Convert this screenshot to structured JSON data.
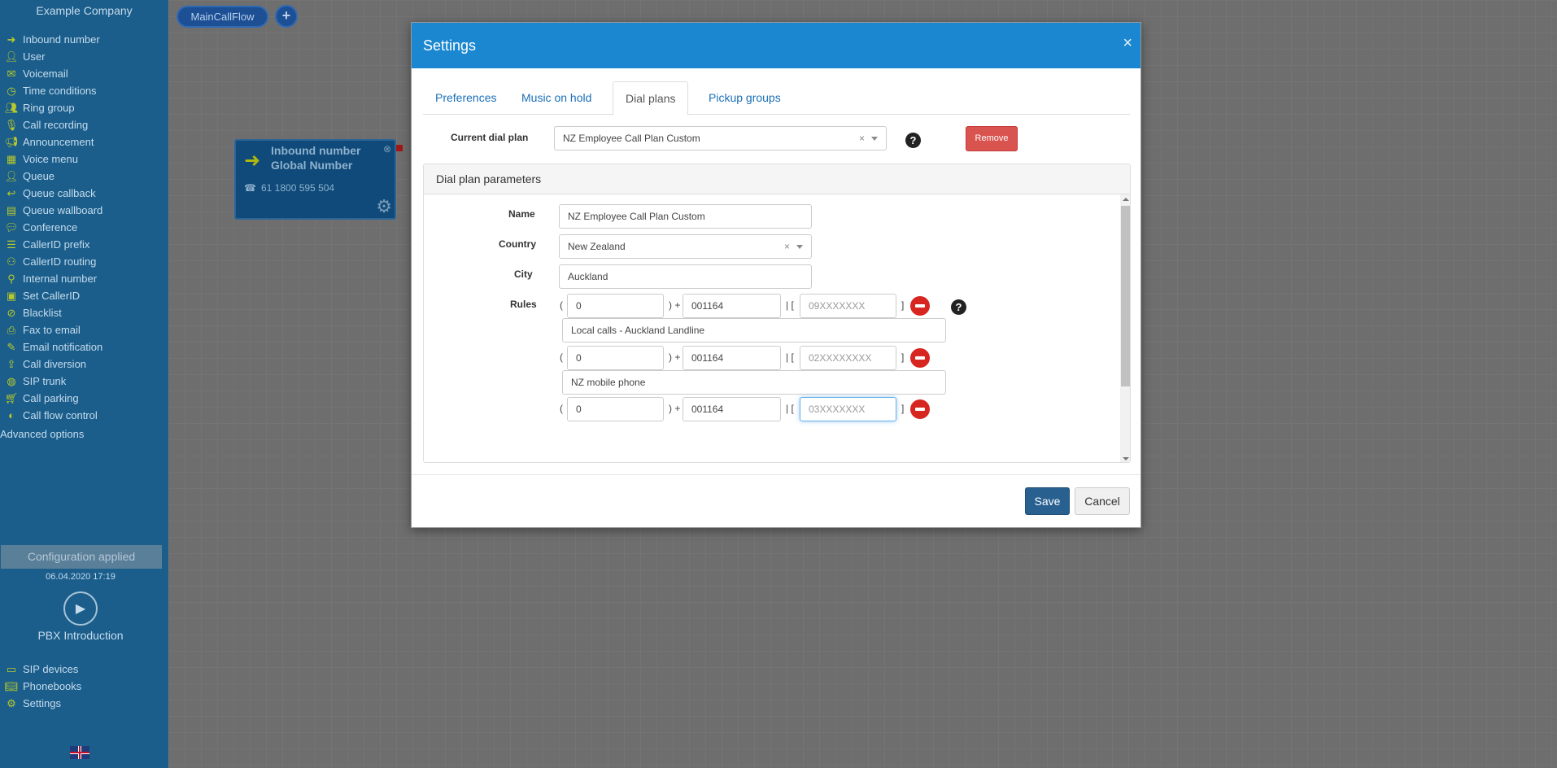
{
  "sidebar": {
    "company": "Example Company",
    "items": [
      {
        "label": "Inbound number",
        "icon": "arrow-right-icon"
      },
      {
        "label": "User",
        "icon": "user-icon"
      },
      {
        "label": "Voicemail",
        "icon": "envelope-icon"
      },
      {
        "label": "Time conditions",
        "icon": "clock-icon"
      },
      {
        "label": "Ring group",
        "icon": "users-icon"
      },
      {
        "label": "Call recording",
        "icon": "microphone-icon"
      },
      {
        "label": "Announcement",
        "icon": "megaphone-icon"
      },
      {
        "label": "Voice menu",
        "icon": "grid-icon"
      },
      {
        "label": "Queue",
        "icon": "user-plus-icon"
      },
      {
        "label": "Queue callback",
        "icon": "reply-icon"
      },
      {
        "label": "Queue wallboard",
        "icon": "table-icon"
      },
      {
        "label": "Conference",
        "icon": "comments-icon"
      },
      {
        "label": "CallerID prefix",
        "icon": "list-icon"
      },
      {
        "label": "CallerID routing",
        "icon": "sitemap-icon"
      },
      {
        "label": "Internal number",
        "icon": "map-marker-icon"
      },
      {
        "label": "Set CallerID",
        "icon": "id-card-icon"
      },
      {
        "label": "Blacklist",
        "icon": "ban-icon"
      },
      {
        "label": "Fax to email",
        "icon": "fax-icon"
      },
      {
        "label": "Email notification",
        "icon": "email-notify-icon"
      },
      {
        "label": "Call diversion",
        "icon": "upload-icon"
      },
      {
        "label": "SIP trunk",
        "icon": "globe-icon"
      },
      {
        "label": "Call parking",
        "icon": "cart-icon"
      },
      {
        "label": "Call flow control",
        "icon": "toggle-icon"
      }
    ],
    "advanced": "Advanced options",
    "config_applied": "Configuration applied",
    "config_time": "06.04.2020 17:19",
    "pbx_intro": "PBX Introduction",
    "bottom_items": [
      {
        "label": "SIP devices",
        "icon": "monitor-icon"
      },
      {
        "label": "Phonebooks",
        "icon": "book-icon"
      },
      {
        "label": "Settings",
        "icon": "gear-icon"
      }
    ]
  },
  "canvas": {
    "flow_tab": "MainCallFlow",
    "node": {
      "title": "Inbound number",
      "subtitle": "Global Number",
      "number": "61 1800 595 504"
    }
  },
  "modal": {
    "title": "Settings",
    "tabs": [
      "Preferences",
      "Music on hold",
      "Dial plans",
      "Pickup groups"
    ],
    "active_tab": "Dial plans",
    "current_dial_plan_label": "Current dial plan",
    "current_dial_plan_value": "NZ Employee Call Plan Custom",
    "remove_label": "Remove",
    "panel_title": "Dial plan parameters",
    "name_label": "Name",
    "name_value": "NZ Employee Call Plan Custom",
    "country_label": "Country",
    "country_value": "New Zealand",
    "city_label": "City",
    "city_value": "Auckland",
    "rules_label": "Rules",
    "rules": [
      {
        "strip": "0",
        "prefix": "001164",
        "pattern": "09XXXXXXX",
        "description": "Local calls - Auckland Landline"
      },
      {
        "strip": "0",
        "prefix": "001164",
        "pattern": "02XXXXXXXX",
        "description": "NZ mobile phone"
      },
      {
        "strip": "0",
        "prefix": "001164",
        "pattern": "03XXXXXXX",
        "description": ""
      }
    ],
    "sym_open": "(",
    "sym_plus": ") +",
    "sym_bracket": "| [",
    "sym_close": "]",
    "save_label": "Save",
    "cancel_label": "Cancel"
  },
  "colors": {
    "sidebar_bg": "#1b5e8c",
    "header_blue": "#1a87d0",
    "remove_red": "#d9534f",
    "save_blue": "#286090",
    "icon_yellow": "#b8c92a"
  }
}
